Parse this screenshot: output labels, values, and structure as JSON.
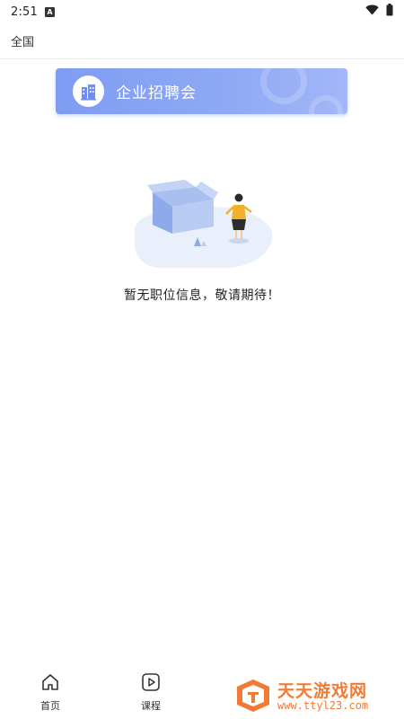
{
  "status_bar": {
    "time": "2:51",
    "notification_badge": "A",
    "icons": [
      "wifi-icon",
      "battery-icon"
    ]
  },
  "header": {
    "region": "全国"
  },
  "banner": {
    "title": "企业招聘会",
    "icon": "building-icon",
    "arrow_icon": "chevron-right-icon",
    "colors": {
      "start": "#7e9cf2",
      "end": "#a3b7f8"
    }
  },
  "empty_state": {
    "message": "暂无职位信息，敬请期待！",
    "illustration": "empty-box-illustration"
  },
  "bottom_nav": {
    "items": [
      {
        "label": "首页",
        "icon": "home-icon"
      },
      {
        "label": "课程",
        "icon": "play-icon"
      }
    ]
  },
  "watermark": {
    "title": "天天游戏网",
    "url": "www.ttyl23.com",
    "color": "#f17a34"
  }
}
